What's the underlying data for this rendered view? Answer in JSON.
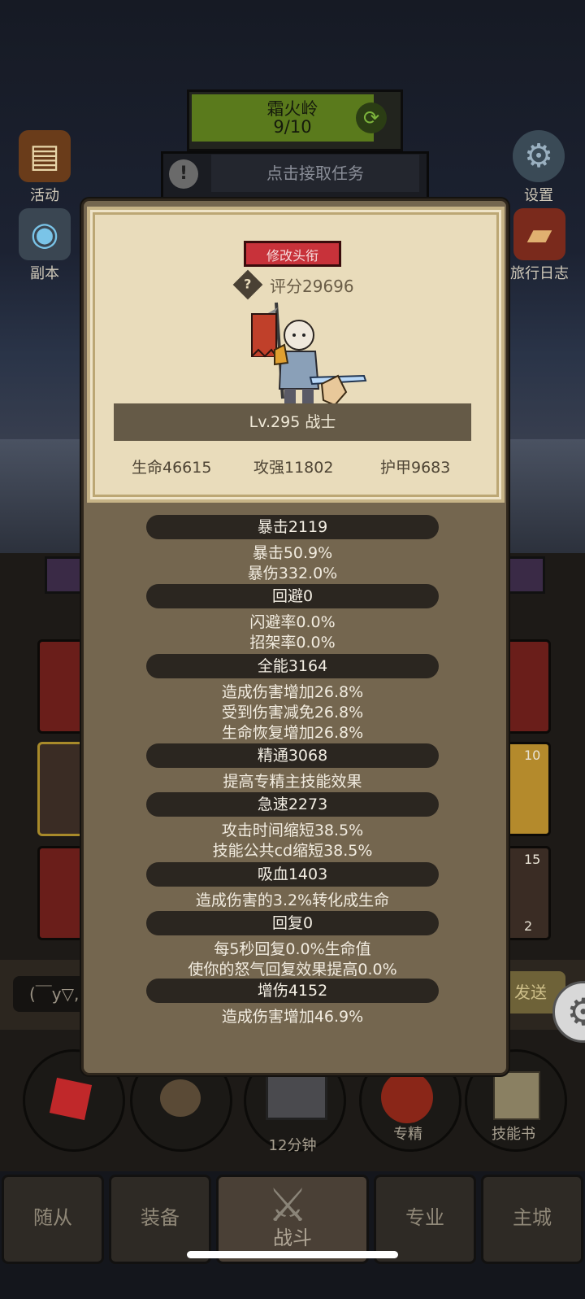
{
  "hud": {
    "zone_name": "霜火岭",
    "zone_progress": "9/10",
    "quest_label": "点击接取任务",
    "left_menu": [
      {
        "label": "活动",
        "icon": "scroll-icon"
      },
      {
        "label": "副本",
        "icon": "portal-icon"
      }
    ],
    "right_menu": [
      {
        "label": "设置",
        "icon": "gear-icon"
      },
      {
        "label": "旅行日志",
        "icon": "book-icon"
      }
    ]
  },
  "chat": {
    "input_text": "(￣y▽,",
    "send_label": "发送"
  },
  "side_counts": [
    "10",
    "15",
    "2"
  ],
  "character": {
    "change_title_label": "修改头衔",
    "score": "评分29696",
    "level_class": "Lv.295 战士",
    "hp": "生命46615",
    "attack": "攻强11802",
    "armor": "护甲9683"
  },
  "stats": [
    {
      "header": "暴击2119",
      "lines": [
        "暴击50.9%",
        "暴伤332.0%"
      ]
    },
    {
      "header": "回避0",
      "lines": [
        "闪避率0.0%",
        "招架率0.0%"
      ]
    },
    {
      "header": "全能3164",
      "lines": [
        "造成伤害增加26.8%",
        "受到伤害减免26.8%",
        "生命恢复增加26.8%"
      ]
    },
    {
      "header": "精通3068",
      "lines": [
        "提高专精主技能效果"
      ]
    },
    {
      "header": "急速2273",
      "lines": [
        "攻击时间缩短38.5%",
        "技能公共cd缩短38.5%"
      ]
    },
    {
      "header": "吸血1403",
      "lines": [
        "造成伤害的3.2%转化成生命"
      ]
    },
    {
      "header": "回复0",
      "lines": [
        "每5秒回复0.0%生命值",
        "使你的怒气回复效果提高0.0%"
      ]
    },
    {
      "header": "增伤4152",
      "lines": [
        "造成伤害增加46.9%"
      ]
    }
  ],
  "bottom": {
    "chest_timer": "12分钟",
    "spec_label": "专精",
    "skillbook_label": "技能书"
  },
  "tabs": [
    {
      "label": "随从"
    },
    {
      "label": "装备"
    },
    {
      "label": "战斗"
    },
    {
      "label": "专业"
    },
    {
      "label": "主城"
    }
  ],
  "colors": {
    "title_button": "#c8323a",
    "zone_fill": "#5a7a1c",
    "modal_bg": "#74664f",
    "card_bg": "#e9dcbb"
  }
}
